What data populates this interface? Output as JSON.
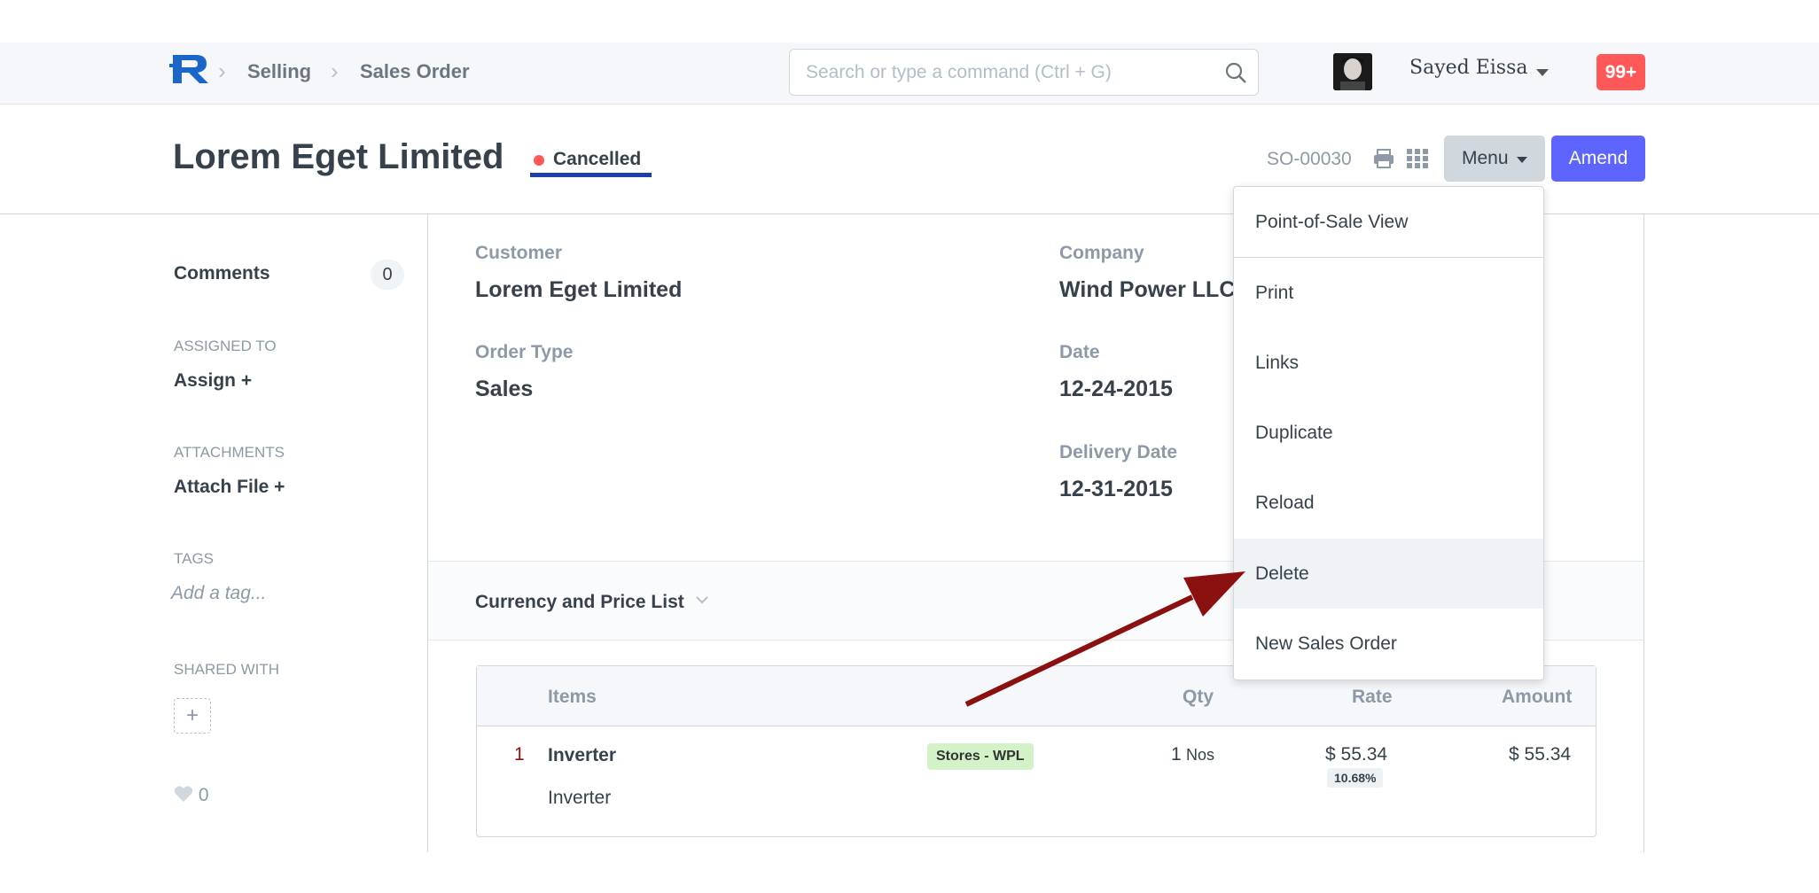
{
  "navbar": {
    "breadcrumbs": [
      "Selling",
      "Sales Order"
    ],
    "search_placeholder": "Search or type a command (Ctrl + G)",
    "user_name": "Sayed Eissa",
    "notifications": "99+"
  },
  "header": {
    "title": "Lorem Eget Limited",
    "status": "Cancelled",
    "doc_name": "SO-00030",
    "menu_label": "Menu",
    "amend_label": "Amend"
  },
  "sidebar": {
    "comments_label": "Comments",
    "comments_count": "0",
    "assigned_to_label": "ASSIGNED TO",
    "assign_label": "Assign +",
    "attachments_label": "ATTACHMENTS",
    "attach_label": "Attach File +",
    "tags_label": "TAGS",
    "tag_placeholder": "Add a tag...",
    "shared_with_label": "SHARED WITH",
    "share_add": "+",
    "likes": "0"
  },
  "form": {
    "customer_label": "Customer",
    "customer_value": "Lorem Eget Limited",
    "order_type_label": "Order Type",
    "order_type_value": "Sales",
    "company_label": "Company",
    "company_value": "Wind Power LLC",
    "date_label": "Date",
    "date_value": "12-24-2015",
    "delivery_date_label": "Delivery Date",
    "delivery_date_value": "12-31-2015",
    "section_title": "Currency and Price List"
  },
  "items_table": {
    "headers": [
      "Items",
      "Qty",
      "Rate",
      "Amount"
    ],
    "rows": [
      {
        "idx": "1",
        "item_code": "Inverter",
        "item_name": "Inverter",
        "warehouse": "Stores - WPL",
        "qty": "1",
        "uom": "Nos",
        "rate": "$ 55.34",
        "discount": "10.68%",
        "amount": "$ 55.34"
      }
    ]
  },
  "menu_dropdown": {
    "items": [
      "Point-of-Sale View",
      "Print",
      "Links",
      "Duplicate",
      "Reload",
      "Delete",
      "New Sales Order"
    ],
    "highlighted": "Delete"
  },
  "colors": {
    "primary": "#5e64ff",
    "danger": "#ff5858",
    "status_underline": "#1f3dac",
    "annotation_arrow": "#8b1010"
  }
}
